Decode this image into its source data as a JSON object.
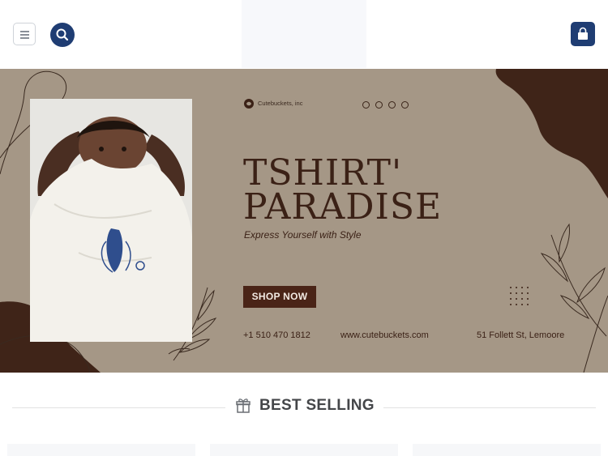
{
  "header": {
    "menu_icon": "hamburger-icon",
    "search_icon": "search-icon",
    "cart_icon": "shopping-bag-icon",
    "accent_color": "#1f3d73"
  },
  "banner": {
    "brand_name": "Cutebuckets, inc",
    "title_line1": "TSHIRT'",
    "title_line2": "PARADISE",
    "subtitle": "Express Yourself with Style",
    "cta_label": "SHOP NOW",
    "phone": "+1 510 470 1812",
    "website": "www.cutebuckets.com",
    "address": "51 Follett St, Lemoore",
    "colors": {
      "background": "#a59786",
      "dark": "#4a2417"
    }
  },
  "best_selling": {
    "heading": "BEST SELLING",
    "icon": "gift-icon"
  }
}
